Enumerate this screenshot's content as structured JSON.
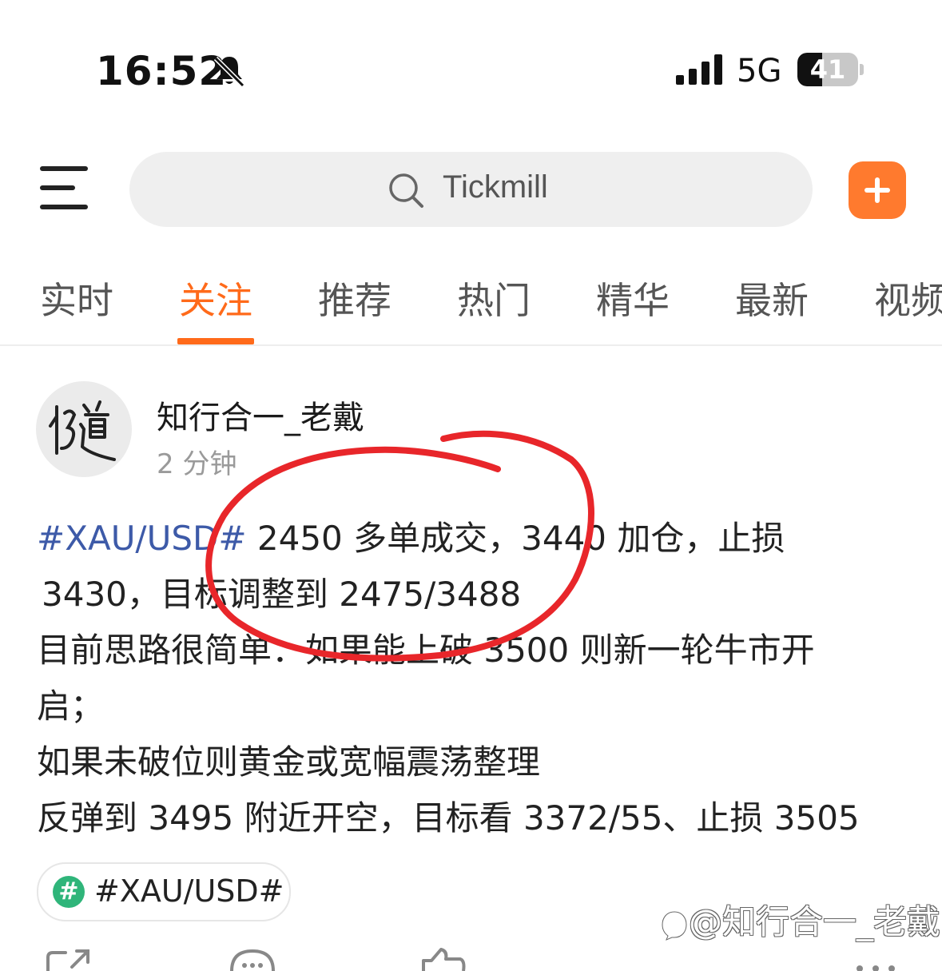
{
  "status_bar": {
    "time": "16:52",
    "network": "5G",
    "battery": "41",
    "battery_level": 0.41,
    "icons": [
      "bell-muted-icon",
      "signal-icon"
    ]
  },
  "header": {
    "search_placeholder": "Tickmill",
    "icons": [
      "menu-icon",
      "search-icon",
      "add-icon"
    ],
    "accent_color": "#ff6a1a"
  },
  "tabs": [
    {
      "label": "实时",
      "active": false
    },
    {
      "label": "关注",
      "active": true
    },
    {
      "label": "推荐",
      "active": false
    },
    {
      "label": "热门",
      "active": false
    },
    {
      "label": "精华",
      "active": false
    },
    {
      "label": "最新",
      "active": false
    },
    {
      "label": "视频",
      "active": false
    }
  ],
  "post": {
    "author": "知行合一_老戴",
    "time": "2 分钟",
    "hashtag": "#XAU/USD#",
    "lines": [
      " 2450 多单成交，3440 加仓，止损",
      "3430，目标调整到 2475/3488",
      "目前思路很简单：如果能上破 3500 则新一轮牛市开",
      "启；",
      "如果未破位则黄金或宽幅震荡整理",
      "反弹到 3495 附近开空，目标看 3372/55、止损 3505"
    ],
    "tag_chip": "#XAU/USD#",
    "annotation_color": "#e8262a"
  },
  "watermark": "@知行合一_老戴"
}
